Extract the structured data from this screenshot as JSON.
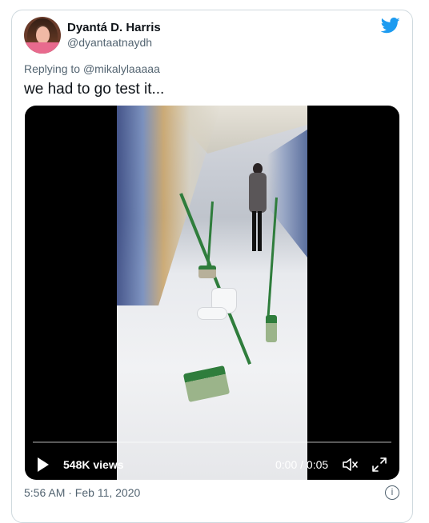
{
  "author": {
    "name": "Dyantá D. Harris",
    "handle": "@dyantaatnaydh"
  },
  "reply": {
    "prefix": "Replying to",
    "to": "@mikalylaaaaa"
  },
  "tweet_text": "we had to go test it...",
  "video": {
    "views": "548K views",
    "time": "0:00 / 0:05",
    "progress": 0
  },
  "timestamp": "5:56 AM · Feb 11, 2020",
  "icons": {
    "brand": "twitter-bird-icon",
    "play": "play-icon",
    "volume": "volume-icon",
    "fullscreen": "fullscreen-icon",
    "info": "info-icon"
  },
  "colors": {
    "brand": "#1d9bf0",
    "muted_text": "#536471",
    "primary_text": "#0f1419"
  }
}
